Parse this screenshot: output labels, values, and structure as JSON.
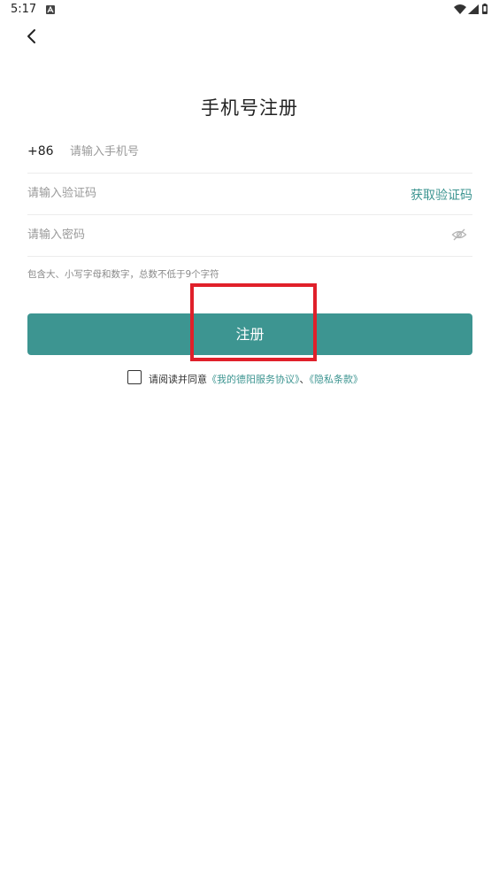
{
  "status_bar": {
    "time": "5:17",
    "notification_icon": "a-letter-icon",
    "right_icons": [
      "wifi-icon",
      "signal-icon",
      "battery-icon"
    ]
  },
  "header": {
    "back_icon": "chevron-left-icon",
    "title": "手机号注册"
  },
  "form": {
    "phone": {
      "country_code": "+86",
      "placeholder": "请输入手机号",
      "value": ""
    },
    "code": {
      "placeholder": "请输入验证码",
      "value": "",
      "get_code_label": "获取验证码"
    },
    "password": {
      "placeholder": "请输入密码",
      "value": "",
      "toggle_icon": "eye-off-icon"
    },
    "password_hint": "包含大、小写字母和数字，总数不低于9个字符"
  },
  "register_button": {
    "label": "注册"
  },
  "agreement": {
    "checked": false,
    "prefix": "请阅读并同意",
    "service_link": "《我的德阳服务协议》",
    "separator": "、",
    "privacy_link": "《隐私条款》"
  },
  "colors": {
    "accent": "#3d9591",
    "highlight": "#e0202a",
    "placeholder": "#9a9a9a"
  }
}
